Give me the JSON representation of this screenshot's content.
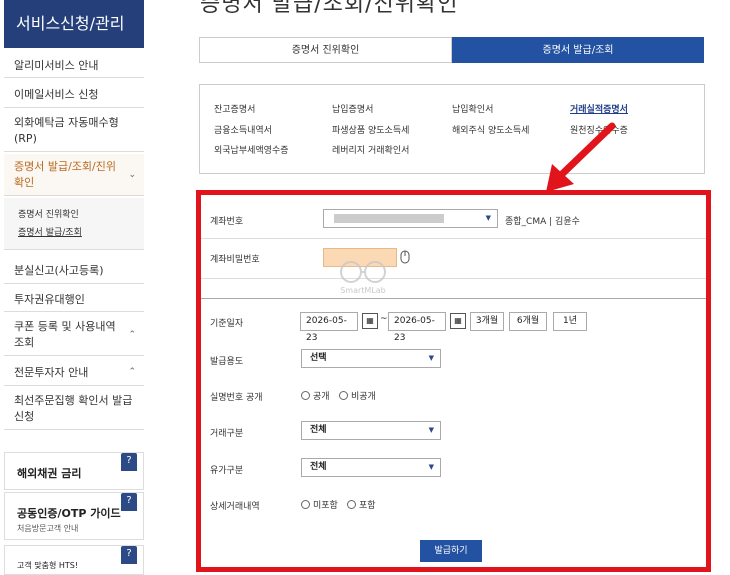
{
  "page": {
    "title": "증명서 발급/조회/진위확인"
  },
  "sidebar": {
    "header": "서비스신청/관리",
    "items": [
      {
        "label": "알리미서비스 안내"
      },
      {
        "label": "이메일서비스 신청"
      },
      {
        "label": "외화예탁금 자동매수형(RP)"
      },
      {
        "label": "증명서 발급/조회/진위 확인"
      },
      {
        "label": "분실신고(사고등록)"
      },
      {
        "label": "투자권유대행인"
      },
      {
        "label": "쿠폰 등록 및 사용내역 조회"
      },
      {
        "label": "전문투자자 안내"
      },
      {
        "label": "최선주문집행 확인서 발급 신청"
      }
    ],
    "subitems": [
      {
        "label": "증명서 진위확인"
      },
      {
        "label": "증명서 발급/조회"
      }
    ],
    "cards": [
      {
        "title": "해외채권 금리",
        "badge": "?"
      },
      {
        "title": "공동인증/OTP 가이드",
        "subtitle": "처음방문고객 안내",
        "badge": "?"
      },
      {
        "title": "고객 맞춤형 HTS!",
        "badge": "?"
      }
    ]
  },
  "tabs": [
    {
      "label": "증명서 진위확인"
    },
    {
      "label": "증명서 발급/조회"
    }
  ],
  "cert_links": [
    {
      "label": "잔고증명서"
    },
    {
      "label": "납입증명서"
    },
    {
      "label": "납입확인서"
    },
    {
      "label": "거래실적증명서"
    },
    {
      "label": "금융소득내역서"
    },
    {
      "label": "파생상품 양도소득세"
    },
    {
      "label": "해외주식 양도소득세"
    },
    {
      "label": "원천징수영수증"
    },
    {
      "label": "외국납부세액영수증"
    },
    {
      "label": "레버리지 거래확인서"
    }
  ],
  "form": {
    "account_label": "계좌번호",
    "account_value": "",
    "account_type": "종합_CMA",
    "account_owner": "김윤수",
    "password_label": "계좌비밀번호",
    "base_date_label": "기준일자",
    "date_from": "2026-05-23",
    "date_sep": "~",
    "date_to": "2026-05-23",
    "period_buttons": [
      "3개월",
      "6개월",
      "1년"
    ],
    "purpose_label": "발급용도",
    "purpose_value": "선택",
    "realname_label": "실명번호 공개",
    "realname_options": [
      "공개",
      "비공개"
    ],
    "trade_type_label": "거래구분",
    "trade_type_value": "전체",
    "security_type_label": "유가구분",
    "security_type_value": "전체",
    "detail_label": "상세거래내역",
    "detail_options": [
      "미포함",
      "포함"
    ],
    "submit_label": "발급하기"
  },
  "watermark": {
    "text": "SmartMLab"
  },
  "colors": {
    "navy": "#243f7a",
    "tab_active": "#2352a2",
    "highlight_red": "#e0141a",
    "active_orange": "#b96a1f"
  }
}
